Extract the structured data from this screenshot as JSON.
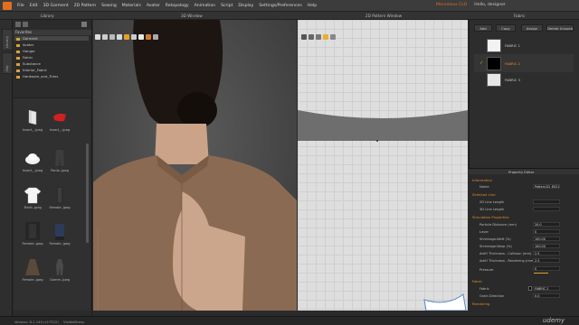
{
  "menubar": {
    "items": [
      "File",
      "Edit",
      "3D Garment",
      "2D Pattern",
      "Sewing",
      "Materials",
      "Avatar",
      "Retopology",
      "Animation",
      "Script",
      "Display",
      "Settings/Preferences",
      "Help"
    ],
    "right": [
      "Marvelous CLO",
      "Hello, designer"
    ]
  },
  "panes": {
    "library": "Library",
    "window3d": "3D Window",
    "window2d": "2D Pattern Window",
    "fabric": "Fabric",
    "property": "Property Editor"
  },
  "leftstrip": {
    "tab1": "Library",
    "tab2": "Obj"
  },
  "library": {
    "favorites_label": "Favorites",
    "items": [
      "Garment",
      "Avatar",
      "Hanger",
      "Fabric",
      "Substance",
      "Interior_Fabric",
      "Hardware_and_Trims"
    ],
    "thumbs": [
      {
        "label": "Insert_..jpeg"
      },
      {
        "label": "Insert_..jpeg"
      },
      {
        "label": "Insert_..jpeg"
      },
      {
        "label": "Pants..jpeg"
      },
      {
        "label": "Tshirt..jpeg"
      },
      {
        "label": "Female..jpeg"
      },
      {
        "label": "Female..jpeg"
      },
      {
        "label": "Female..jpeg"
      },
      {
        "label": "Female..jpeg"
      },
      {
        "label": "Gamm..jpeg"
      }
    ]
  },
  "fabric_panel": {
    "buttons": [
      "Add",
      "Copy",
      "Assign",
      "Delete Unused"
    ],
    "fabrics": [
      {
        "name": "FABRIC 1",
        "color": "#f2f2f2"
      },
      {
        "name": "FABRIC 2",
        "color": "#000000"
      },
      {
        "name": "FABRIC 3",
        "color": "#e6e6e6"
      }
    ]
  },
  "property_editor": {
    "sections": {
      "information": "Information",
      "selected_line": "Selected Line",
      "simulation": "Simulation Properties",
      "fabric": "Fabric",
      "rendering": "Rendering"
    },
    "rows": [
      {
        "label": "Name",
        "value": "Pattern2D_852172"
      },
      {
        "label": "2D Line Length",
        "value": ""
      },
      {
        "label": "3D Line Length",
        "value": ""
      },
      {
        "label": "Particle Distance (mm)",
        "value": "20.0"
      },
      {
        "label": "Layer",
        "value": "0"
      },
      {
        "label": "Shrinkage-Weft (%)",
        "value": "100.00"
      },
      {
        "label": "Shrinkage-Warp (%)",
        "value": "100.00"
      },
      {
        "label": "Add'l Thickness - Collision (mm)",
        "value": "2.5"
      },
      {
        "label": "Add'l Thickness - Rendering (mm)",
        "value": "2.5"
      },
      {
        "label": "Pressure",
        "value": "0"
      },
      {
        "label": "Fabric",
        "value": "FABRIC 2"
      },
      {
        "label": "Grain Direction",
        "value": "0.0"
      }
    ]
  },
  "statusbar": {
    "version": "Version: 8.1.149 (r27322)",
    "right": "VisibleDress"
  },
  "watermark": "udemy",
  "colors": {
    "accent": "#e0822a",
    "skin": "#caa389",
    "shirt": "#8a6a52"
  }
}
